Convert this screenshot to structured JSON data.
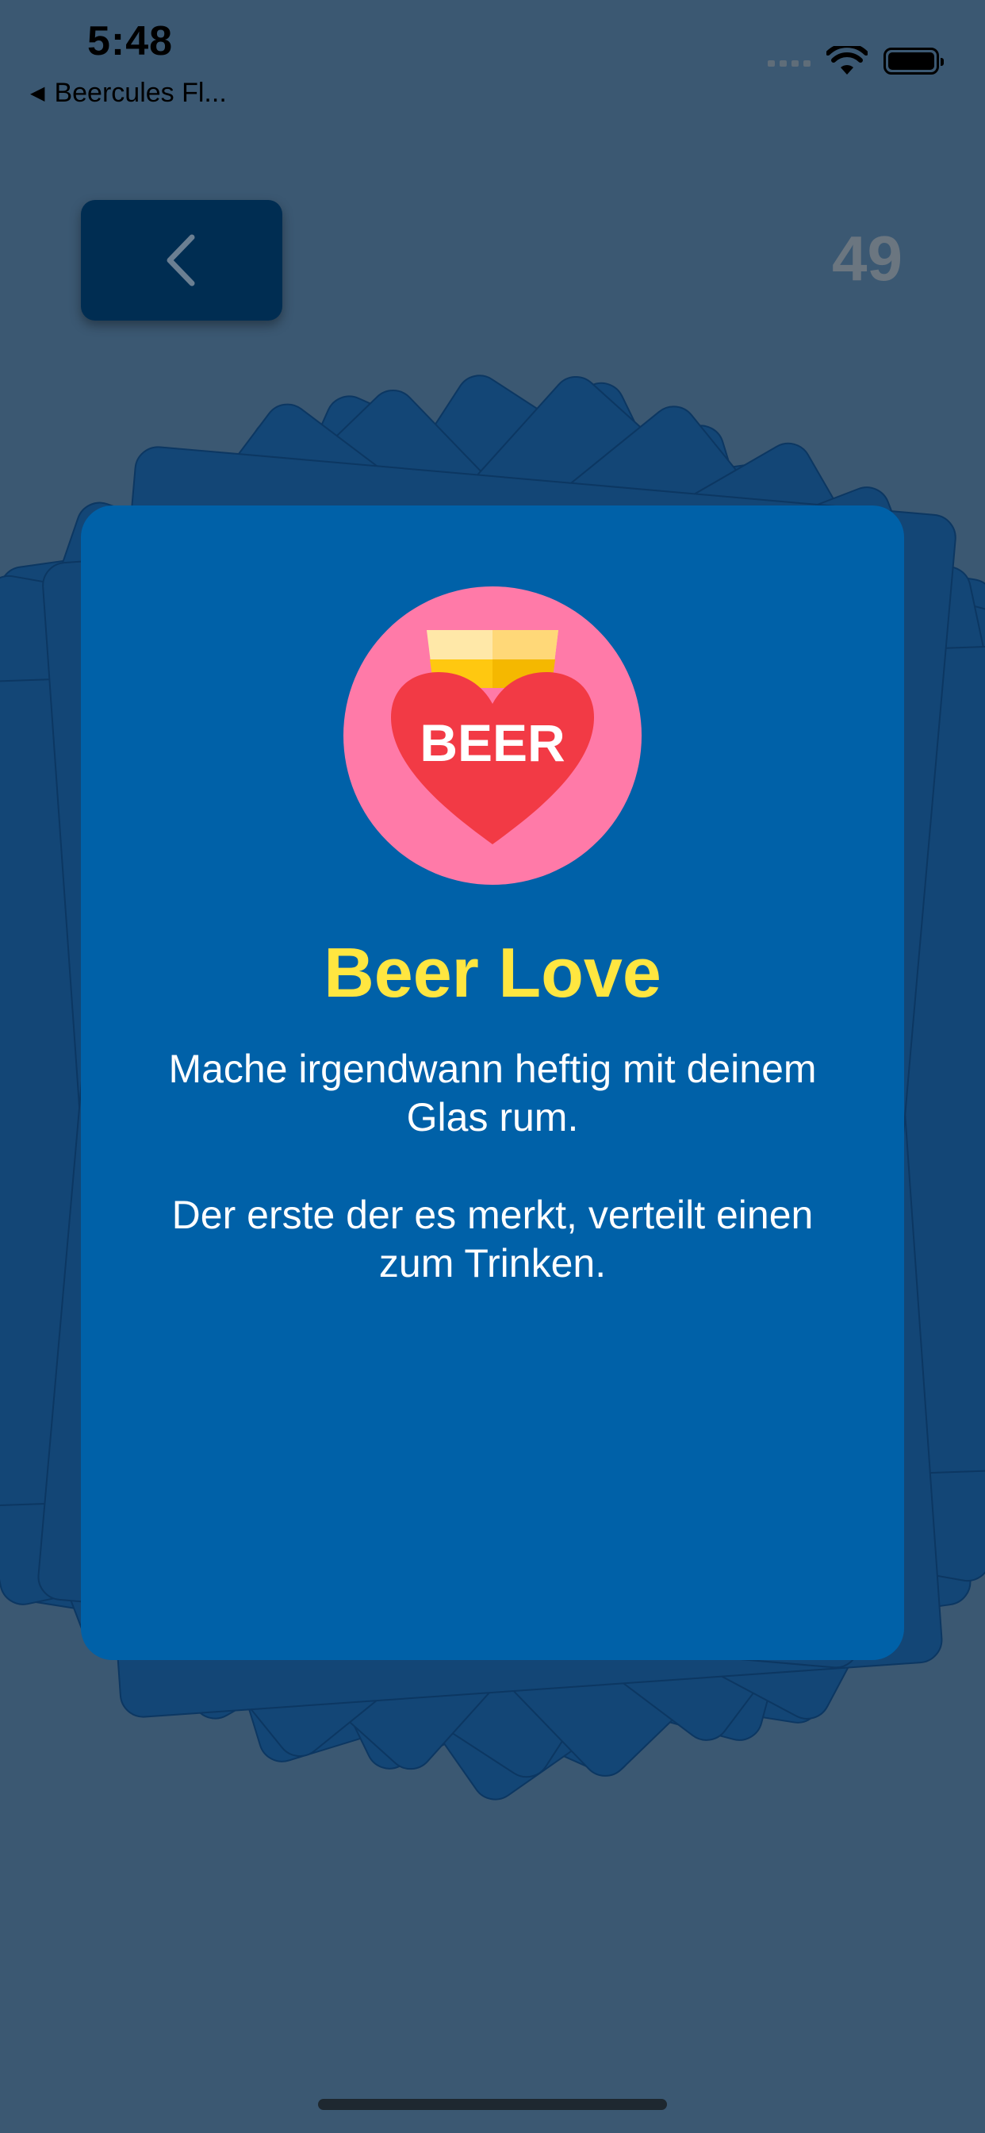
{
  "status_bar": {
    "time": "5:48",
    "back_app_label": "Beercules Fl...",
    "back_app_icon": "back-triangle-icon",
    "icons": [
      "cellular-signal-icon",
      "wifi-icon",
      "battery-icon"
    ]
  },
  "header": {
    "back_icon": "chevron-left-icon",
    "counter": "49"
  },
  "card": {
    "badge_text": "BEER",
    "title": "Beer Love",
    "paragraph_1": "Mache irgendwann heftig mit deinem Glas rum.",
    "paragraph_2": "Der erste der es merkt, verteilt einen zum Trinken."
  },
  "colors": {
    "background": "#3b5872",
    "deck_card": "#134676",
    "card": "#0061a8",
    "title": "#ffe640",
    "back_button": "#002d52",
    "badge_circle": "#ff7aa8",
    "heart": "#f23a45",
    "beer_light": "#ffe8a8",
    "beer_gold": "#ffc810"
  }
}
